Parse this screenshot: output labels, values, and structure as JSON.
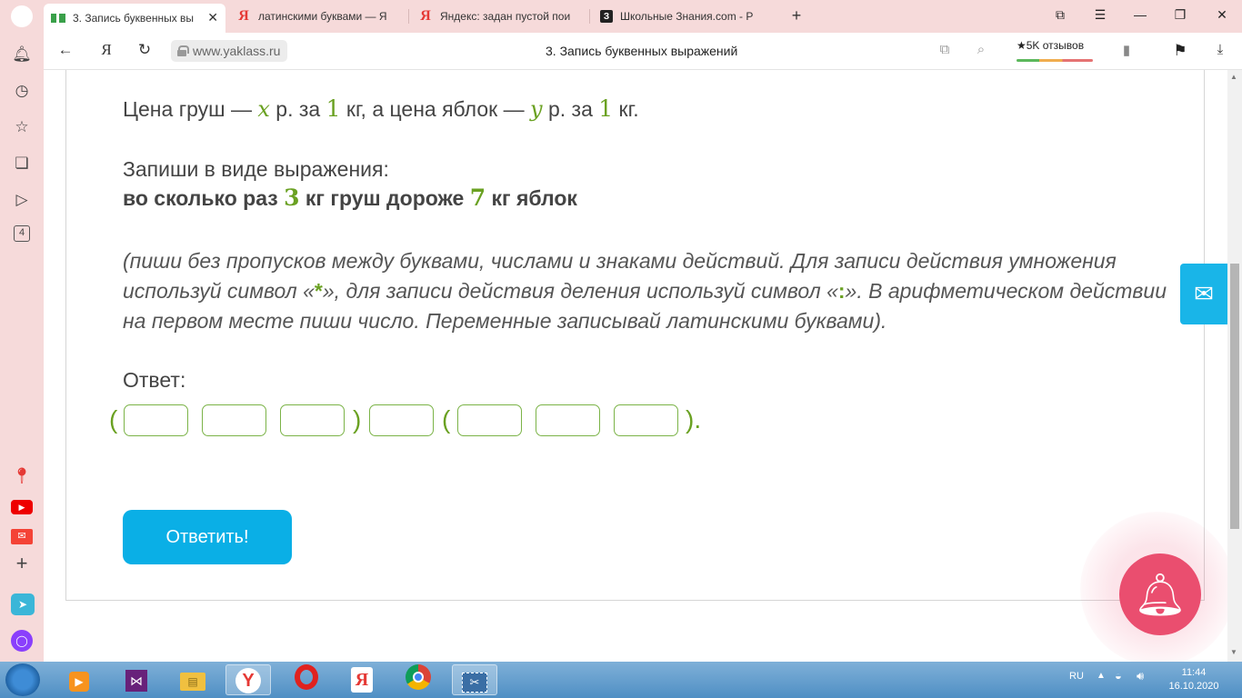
{
  "tabs": [
    {
      "title": "3. Запись буквенных вы",
      "favicon": "yaklass-icon",
      "active": true
    },
    {
      "title": "латинскими буквами — Я",
      "favicon": "yandex-icon",
      "active": false
    },
    {
      "title": "Яндекс: задан пустой пои",
      "favicon": "yandex-icon",
      "active": false
    },
    {
      "title": "Школьные Знания.com - Р",
      "favicon": "znania-icon",
      "active": false
    }
  ],
  "favicons": {
    "yandex": "Я",
    "znania": "З"
  },
  "address": {
    "url": "www.yaklass.ru",
    "page_title": "3. Запись буквенных выражений",
    "reviews": "★5K отзывов",
    "yandex_glyph": "Я"
  },
  "sidebar": {
    "badge": "4"
  },
  "problem": {
    "line1": {
      "a": "Цена груш — ",
      "x": "x",
      "b": " р. за ",
      "one1": "1",
      "c": " кг, а цена яблок — ",
      "y": "y",
      "d": " р. за ",
      "one2": "1",
      "e": " кг."
    },
    "task_label": "Запиши в виде выражения:",
    "task": {
      "a": "во сколько раз ",
      "n1": "3",
      "b": " кг груш дороже ",
      "n2": "7",
      "c": " кг яблок"
    },
    "hint": {
      "a": "(пиши без пропусков между буквами, числами и знаками действий. Для записи действия умножения используй символ «",
      "mult": "*",
      "b": "», для записи действия деления используй символ «",
      "div": ":",
      "c": "». В арифметическом действии на первом месте пиши число. Переменные записывай латинскими буквами)."
    },
    "answer_label": "Ответ:",
    "answer_fields": [
      "",
      "",
      "",
      "",
      "",
      "",
      ""
    ],
    "parens": {
      "open": "(",
      "close": ")",
      "close_dot": ")."
    },
    "submit_label": "Ответить!"
  },
  "taskbar": {
    "lang": "RU",
    "time": "11:44",
    "date": "16.10.2020",
    "yandex_glyph": "Я"
  },
  "colors": {
    "accent_green": "#6aa122",
    "button_blue": "#0aafe6",
    "bell_pink": "#ea4e6f",
    "tabbar_pink": "#f6dada"
  }
}
